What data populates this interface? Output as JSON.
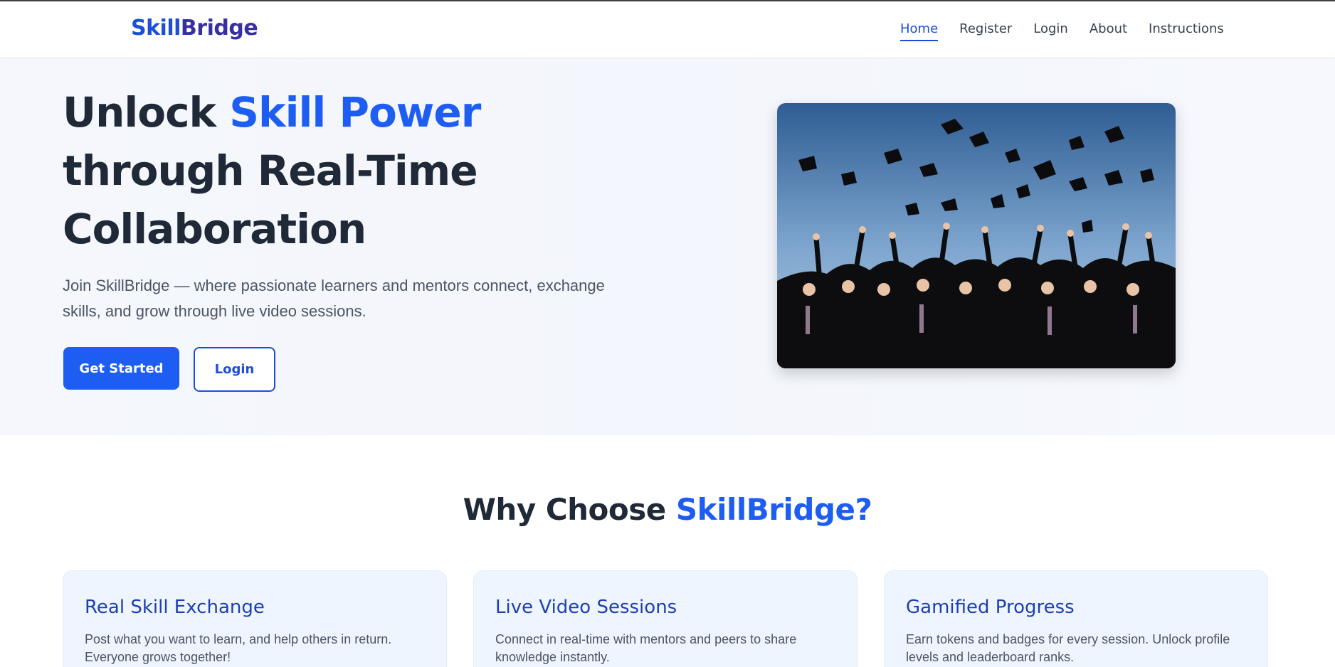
{
  "nav": {
    "brand_part1": "Skill",
    "brand_part2": "Bridge",
    "links": [
      {
        "label": "Home",
        "active": true
      },
      {
        "label": "Register"
      },
      {
        "label": "Login"
      },
      {
        "label": "About"
      },
      {
        "label": "Instructions"
      }
    ]
  },
  "hero": {
    "title_part1": "Unlock ",
    "title_accent": "Skill Power",
    "title_part2": "through Real-Time Collaboration",
    "subtitle": "Join SkillBridge — where passionate learners and mentors connect, exchange skills, and grow through live video sessions.",
    "primary_button": "Get Started",
    "secondary_button": "Login"
  },
  "why": {
    "title_part1": "Why Choose ",
    "title_accent": "SkillBridge?",
    "cards": [
      {
        "title": "Real Skill Exchange",
        "desc": "Post what you want to learn, and help others in return. Everyone grows together!"
      },
      {
        "title": "Live Video Sessions",
        "desc": "Connect in real-time with mentors and peers to share knowledge instantly."
      },
      {
        "title": "Gamified Progress",
        "desc": "Earn tokens and badges for every session. Unlock profile levels and leaderboard ranks."
      }
    ]
  },
  "colors": {
    "accent": "#1d5df2",
    "brand_dark": "#3730a3",
    "card_bg": "#eff5ff"
  }
}
